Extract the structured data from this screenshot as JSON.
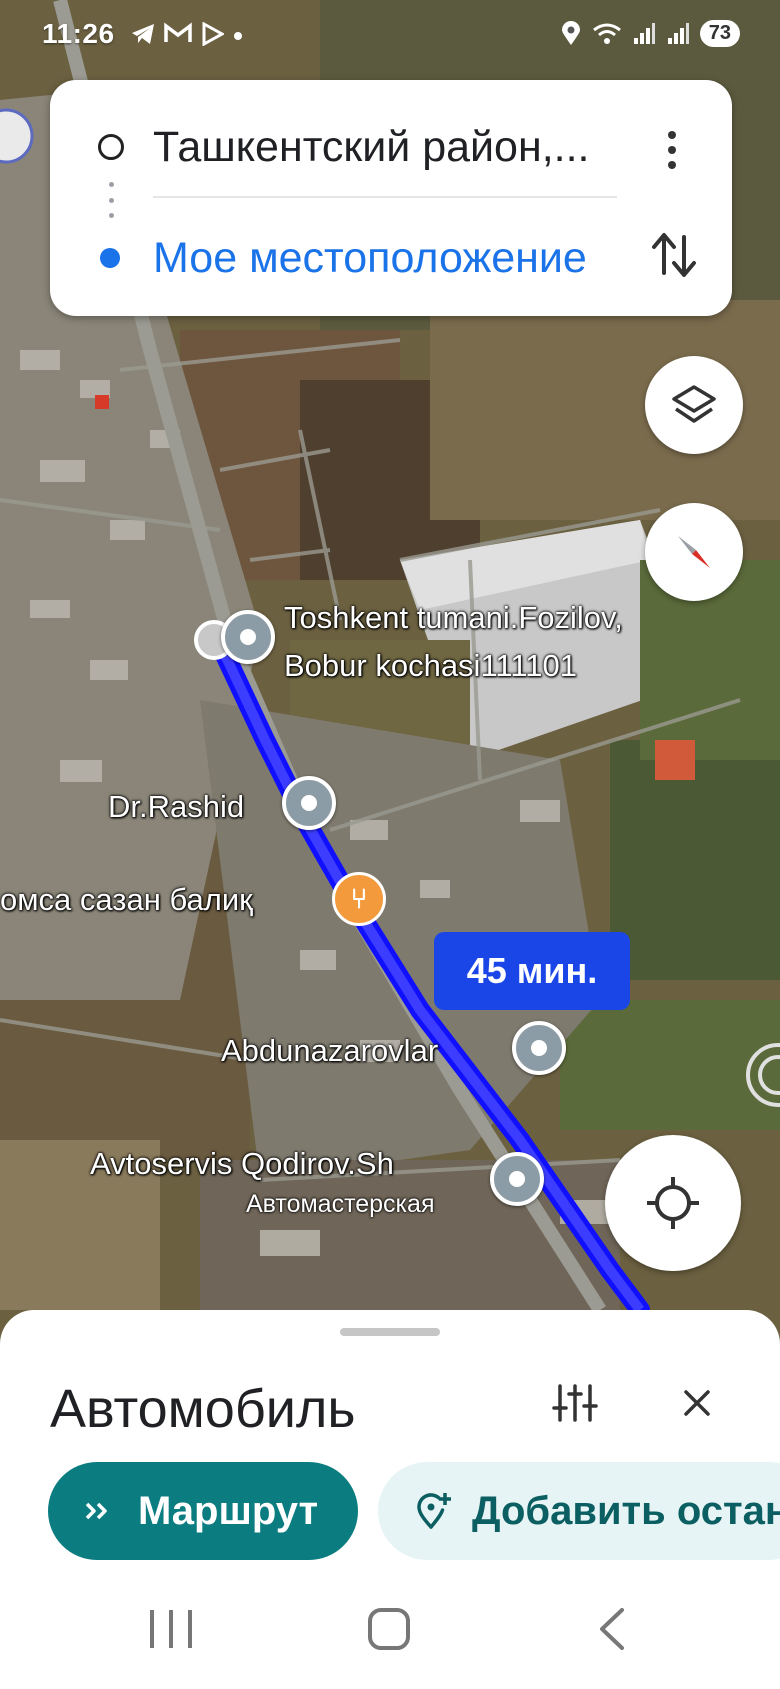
{
  "status_bar": {
    "time": "11:26",
    "battery": "73",
    "left_icons": [
      "telegram-icon",
      "gmail-icon",
      "play-icon",
      "dot-icon"
    ],
    "right_icons": [
      "location-icon",
      "wifi-icon",
      "signal-icon",
      "signal-icon"
    ]
  },
  "route_card": {
    "origin": "Ташкентский район,...",
    "destination": "Мое местоположение"
  },
  "map": {
    "labels": {
      "fozilov_line1": "Toshkent tumani.Fozilov,",
      "fozilov_line2": "Bobur kochasi111101",
      "dr_rashid": "Dr.Rashid",
      "restaurant": "омса сазан балиқ",
      "abdunazarovlar": "Abdunazarovlar",
      "avtoservis": "Avtoservis Qodirov.Sh",
      "avtoservis_sub": "Автомастерская"
    },
    "eta": "45 мин.",
    "route_color": "#1a1aff"
  },
  "sheet": {
    "title": "Автомобиль",
    "route_button": "Маршрут",
    "add_stop_button": "Добавить остано"
  },
  "colors": {
    "accent_blue": "#1a73e8",
    "teal": "#0b7c80",
    "teal_light": "#e7f4f5",
    "eta_blue": "#1a46e8"
  }
}
